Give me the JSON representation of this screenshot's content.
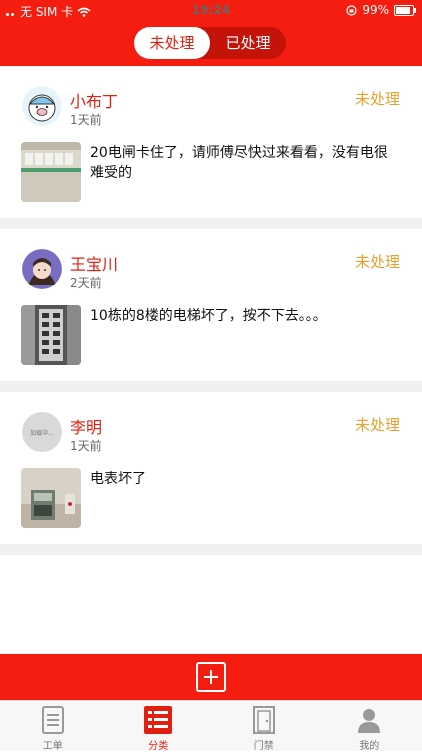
{
  "statusbar": {
    "carrier": "无 SIM 卡",
    "time": "19:24",
    "battery": "99%"
  },
  "segments": {
    "active_label": "未处理",
    "inactive_label": "已处理"
  },
  "tickets": [
    {
      "name": "小布丁",
      "time": "1天前",
      "status": "未处理",
      "description": "20电闸卡住了，请师傅尽快过来看看，没有电很难受的"
    },
    {
      "name": "王宝川",
      "time": "2天前",
      "status": "未处理",
      "description": "10栋的8楼的电梯坏了，按不下去。。。"
    },
    {
      "name": "李明",
      "time": "1天前",
      "status": "未处理",
      "description": "电表坏了",
      "avatar_text": "加载中..."
    }
  ],
  "tabbar": [
    {
      "label": "工单",
      "icon": "document-icon"
    },
    {
      "label": "分类",
      "icon": "list-icon"
    },
    {
      "label": "门禁",
      "icon": "door-icon"
    },
    {
      "label": "我的",
      "icon": "person-icon"
    }
  ],
  "colors": {
    "brand_red": "#f41d0f",
    "status_orange": "#e6a12c",
    "divider": "#efefef"
  }
}
